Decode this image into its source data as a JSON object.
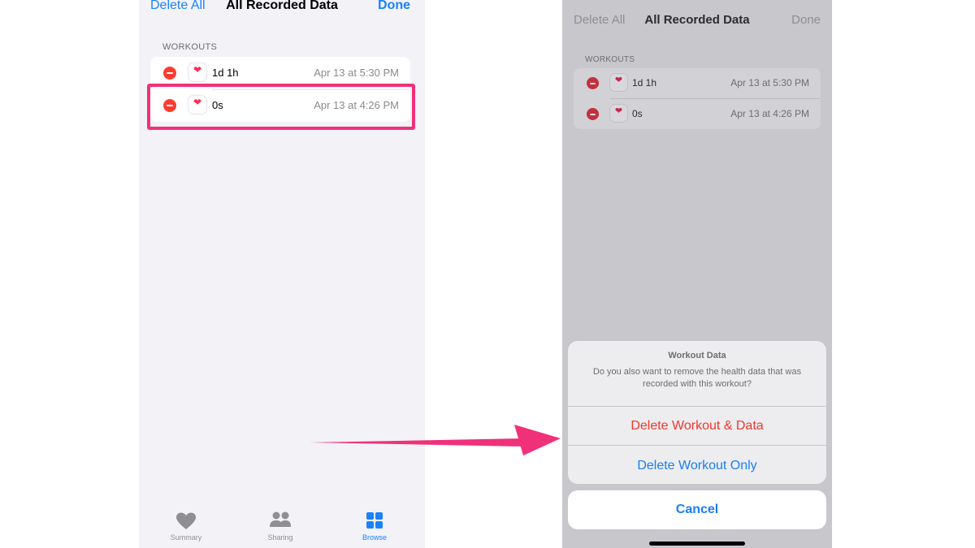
{
  "left": {
    "nav": {
      "left": "Delete All",
      "title": "All Recorded Data",
      "right": "Done"
    },
    "section": "WORKOUTS",
    "rows": [
      {
        "label": "1d 1h",
        "date": "Apr 13 at 5:30 PM"
      },
      {
        "label": "0s",
        "date": "Apr 13 at 4:26 PM"
      }
    ],
    "tabs": [
      {
        "label": "Summary",
        "icon": "heart-icon"
      },
      {
        "label": "Sharing",
        "icon": "people-icon"
      },
      {
        "label": "Browse",
        "icon": "grid-icon"
      }
    ]
  },
  "right": {
    "nav": {
      "left": "Delete All",
      "title": "All Recorded Data",
      "right": "Done"
    },
    "section": "WORKOUTS",
    "rows": [
      {
        "label": "1d 1h",
        "date": "Apr 13 at 5:30 PM"
      },
      {
        "label": "0s",
        "date": "Apr 13 at 4:26 PM"
      }
    ],
    "sheet": {
      "title": "Workout Data",
      "message": "Do you also want to remove the health data that was recorded with this workout?",
      "danger": "Delete Workout & Data",
      "normal": "Delete Workout Only"
    },
    "cancel": "Cancel"
  },
  "colors": {
    "accent": "#1a82fb",
    "danger": "#f0362b",
    "highlight": "#f0317a",
    "heart": "#ff2d55"
  },
  "icons": {
    "row_icon": "heart-icon",
    "delete_icon": "minus-circle-icon",
    "arrow": "arrow-right-icon"
  }
}
